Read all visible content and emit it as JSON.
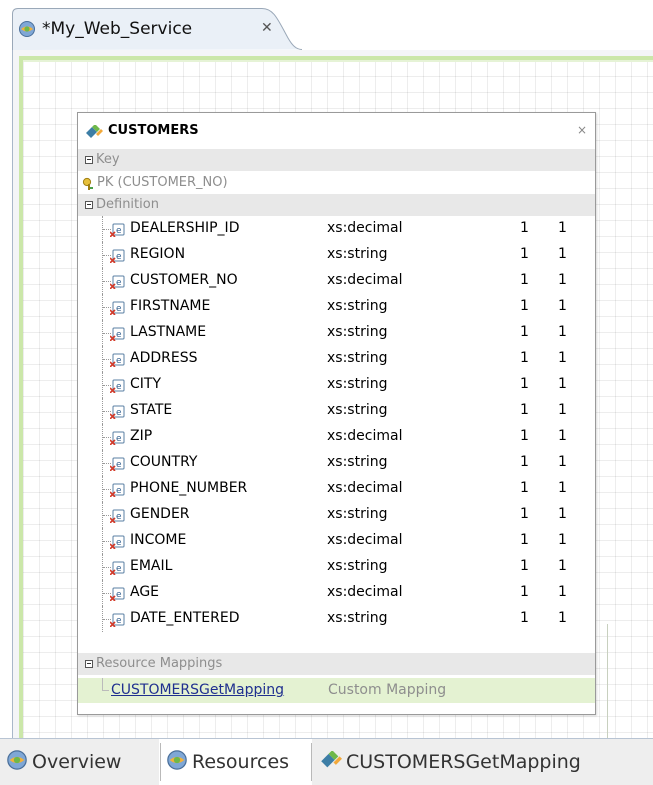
{
  "editor_tab": {
    "title": "*My_Web_Service",
    "close_glyph": "✕",
    "icon": "web-service-icon"
  },
  "table": {
    "title": "CUSTOMERS",
    "close_glyph": "×",
    "icon": "table-icon",
    "sections": {
      "key": "Key",
      "definition": "Definition",
      "resource_mappings": "Resource Mappings"
    },
    "primary_key": "PK (CUSTOMER_NO)",
    "fields": [
      {
        "name": "DEALERSHIP_ID",
        "type": "xs:decimal",
        "min": "1",
        "max": "1"
      },
      {
        "name": "REGION",
        "type": "xs:string",
        "min": "1",
        "max": "1"
      },
      {
        "name": "CUSTOMER_NO",
        "type": "xs:decimal",
        "min": "1",
        "max": "1"
      },
      {
        "name": "FIRSTNAME",
        "type": "xs:string",
        "min": "1",
        "max": "1"
      },
      {
        "name": "LASTNAME",
        "type": "xs:string",
        "min": "1",
        "max": "1"
      },
      {
        "name": "ADDRESS",
        "type": "xs:string",
        "min": "1",
        "max": "1"
      },
      {
        "name": "CITY",
        "type": "xs:string",
        "min": "1",
        "max": "1"
      },
      {
        "name": "STATE",
        "type": "xs:string",
        "min": "1",
        "max": "1"
      },
      {
        "name": "ZIP",
        "type": "xs:decimal",
        "min": "1",
        "max": "1"
      },
      {
        "name": "COUNTRY",
        "type": "xs:string",
        "min": "1",
        "max": "1"
      },
      {
        "name": "PHONE_NUMBER",
        "type": "xs:decimal",
        "min": "1",
        "max": "1"
      },
      {
        "name": "GENDER",
        "type": "xs:string",
        "min": "1",
        "max": "1"
      },
      {
        "name": "INCOME",
        "type": "xs:decimal",
        "min": "1",
        "max": "1"
      },
      {
        "name": "EMAIL",
        "type": "xs:string",
        "min": "1",
        "max": "1"
      },
      {
        "name": "AGE",
        "type": "xs:decimal",
        "min": "1",
        "max": "1"
      },
      {
        "name": "DATE_ENTERED",
        "type": "xs:string",
        "min": "1",
        "max": "1"
      }
    ],
    "mapping": {
      "name": "CUSTOMERSGetMapping",
      "type": "Custom Mapping"
    }
  },
  "bottom_tabs": [
    {
      "label": "Overview",
      "icon": "web-service-icon",
      "active": false
    },
    {
      "label": "Resources",
      "icon": "web-service-icon",
      "active": true
    },
    {
      "label": "CUSTOMERSGetMapping",
      "icon": "mapping-icon",
      "active": false
    }
  ],
  "colors": {
    "canvas_accent": "#cbe7a9",
    "mapping_row_bg": "#e4f2d2",
    "section_bg": "#e8e8e8",
    "link": "#1f2f8f",
    "muted_text": "#8e8e8e"
  }
}
